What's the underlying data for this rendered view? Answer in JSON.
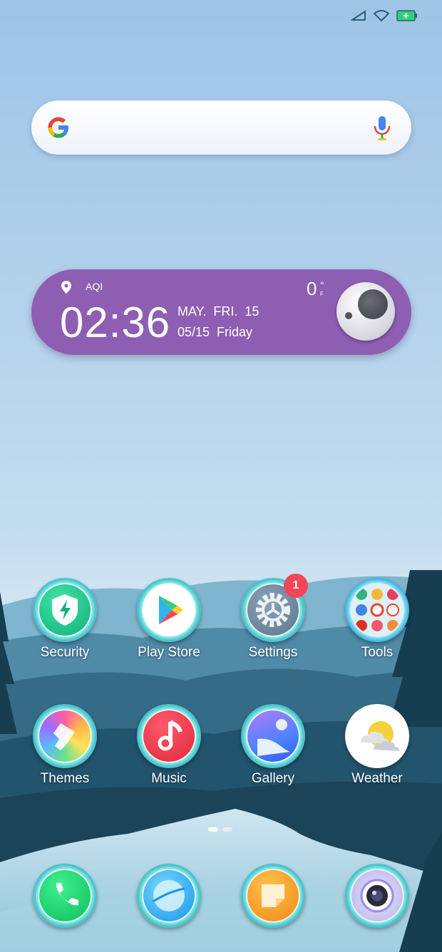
{
  "status_bar": {
    "icons": [
      "signal-icon",
      "wifi-icon",
      "battery-charging-icon"
    ]
  },
  "search_bar": {
    "icons": [
      "google-logo-icon",
      "mic-icon"
    ]
  },
  "clock_widget": {
    "aqi_label": "AQI",
    "time": "02:36",
    "date_line1": "MAY.  FRI.  15",
    "date_line2": "05/15  Friday",
    "temperature": "0",
    "degree_symbol": "°",
    "unit": "F"
  },
  "apps_row1": [
    {
      "label": "Security"
    },
    {
      "label": "Play Store"
    },
    {
      "label": "Settings",
      "badge": "1"
    },
    {
      "label": "Tools"
    }
  ],
  "apps_row2": [
    {
      "label": "Themes"
    },
    {
      "label": "Music"
    },
    {
      "label": "Gallery"
    },
    {
      "label": "Weather"
    }
  ],
  "dock": [
    "phone-icon",
    "browser-icon",
    "notes-icon",
    "camera-icon"
  ],
  "page_indicator": {
    "pages": 2,
    "current": 1
  }
}
